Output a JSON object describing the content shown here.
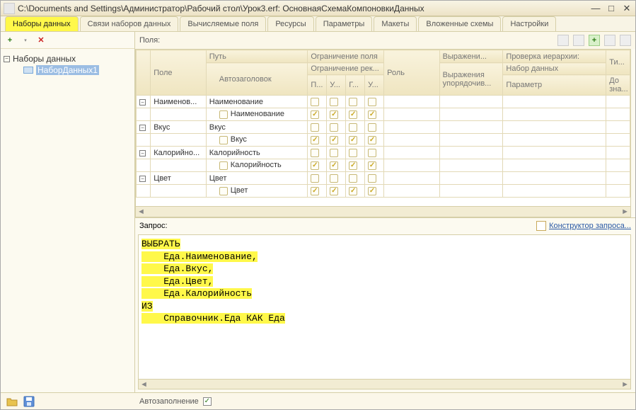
{
  "window": {
    "title": "C:\\Documents and Settings\\Администратор\\Рабочий стол\\Урок3.erf: ОсновнаяСхемаКомпоновкиДанных"
  },
  "tabs": [
    {
      "label": "Наборы данных",
      "active": true
    },
    {
      "label": "Связи наборов данных",
      "active": false
    },
    {
      "label": "Вычисляемые поля",
      "active": false
    },
    {
      "label": "Ресурсы",
      "active": false
    },
    {
      "label": "Параметры",
      "active": false
    },
    {
      "label": "Макеты",
      "active": false
    },
    {
      "label": "Вложенные схемы",
      "active": false
    },
    {
      "label": "Настройки",
      "active": false
    }
  ],
  "tree": {
    "root": "Наборы данных",
    "children": [
      {
        "label": "НаборДанных1",
        "selected": true
      }
    ]
  },
  "fields_label": "Поля:",
  "grid": {
    "headers": {
      "field": "Поле",
      "path": "Путь",
      "auto_title": "Автозаголовок",
      "restrict_field": "Ограничение поля",
      "restrict_req": "Ограничение рек...",
      "sub_p": "П...",
      "sub_u1": "У...",
      "sub_g": "Г...",
      "sub_u2": "У...",
      "role": "Роль",
      "expr": "Выражени...",
      "expr_sort": "Выражения упорядочив...",
      "hier": "Проверка иерархии:",
      "dataset": "Набор данных",
      "param": "Параметр",
      "ti": "Ти...",
      "do": "До зна..."
    },
    "rows": [
      {
        "field": "Наименов...",
        "path": "Наименование",
        "title": "Наименование",
        "selected": true
      },
      {
        "field": "Вкус",
        "path": "Вкус",
        "title": "Вкус",
        "selected": false
      },
      {
        "field": "Калорийно...",
        "path": "Калорийность",
        "title": "Калорийность",
        "selected": false
      },
      {
        "field": "Цвет",
        "path": "Цвет",
        "title": "Цвет",
        "selected": false
      }
    ]
  },
  "query": {
    "label": "Запрос:",
    "constructor_link": "Конструктор запроса...",
    "text": "ВЫБРАТЬ\n    Еда.Наименование,\n    Еда.Вкус,\n    Еда.Цвет,\n    Еда.Калорийность\nИЗ\n    Справочник.Еда КАК Еда"
  },
  "autofill": {
    "label": "Автозаполнение",
    "checked": true
  },
  "icons": {
    "minimize": "—",
    "maximize": "□",
    "close": "✕",
    "add": "+",
    "delete": "✕",
    "dropdown": "▾",
    "arrow_left": "◄",
    "arrow_right": "►",
    "check": "✓"
  }
}
